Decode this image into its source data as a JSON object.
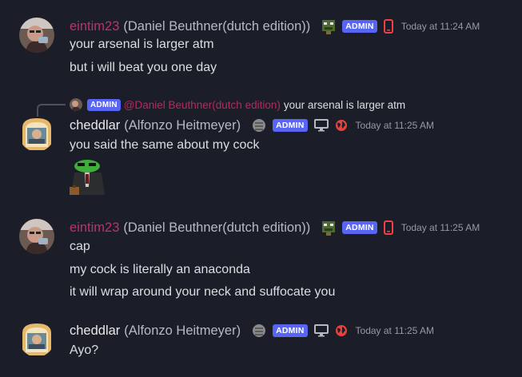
{
  "colors": {
    "background": "#1b1d29",
    "eintim_name": "#c0306a",
    "cheddlar_name": "#e8e8ea",
    "admin_badge": "#5865f2",
    "mention": "#b62a5f",
    "mobile_icon": "#f23f43",
    "globe_icon": "#e8423c"
  },
  "messages": [
    {
      "author": "eintim23",
      "display": "(Daniel Beuthner(dutch edition))",
      "role_badge": "ADMIN",
      "timestamp": "Today at 11:24 AM",
      "lines": [
        "your arsenal is larger atm",
        "but i will beat you one day"
      ]
    },
    {
      "reply": {
        "role_badge": "ADMIN",
        "mention": "@Daniel Beuthner(dutch edition)",
        "text": "your arsenal is larger atm"
      },
      "author": "cheddlar",
      "display": "(Alfonzo Heitmeyer)",
      "role_badge": "ADMIN",
      "timestamp": "Today at 11:25 AM",
      "lines": [
        "you said the same about my cock"
      ],
      "sticker": "pepe-in-suit-sticker"
    },
    {
      "author": "eintim23",
      "display": "(Daniel Beuthner(dutch edition))",
      "role_badge": "ADMIN",
      "timestamp": "Today at 11:25 AM",
      "lines": [
        "cap",
        "my cock is literally an anaconda",
        "it will wrap around your neck and suffocate you"
      ]
    },
    {
      "author": "cheddlar",
      "display": "(Alfonzo Heitmeyer)",
      "role_badge": "ADMIN",
      "timestamp": "Today at 11:25 AM",
      "lines": [
        "Ayo?"
      ]
    }
  ]
}
